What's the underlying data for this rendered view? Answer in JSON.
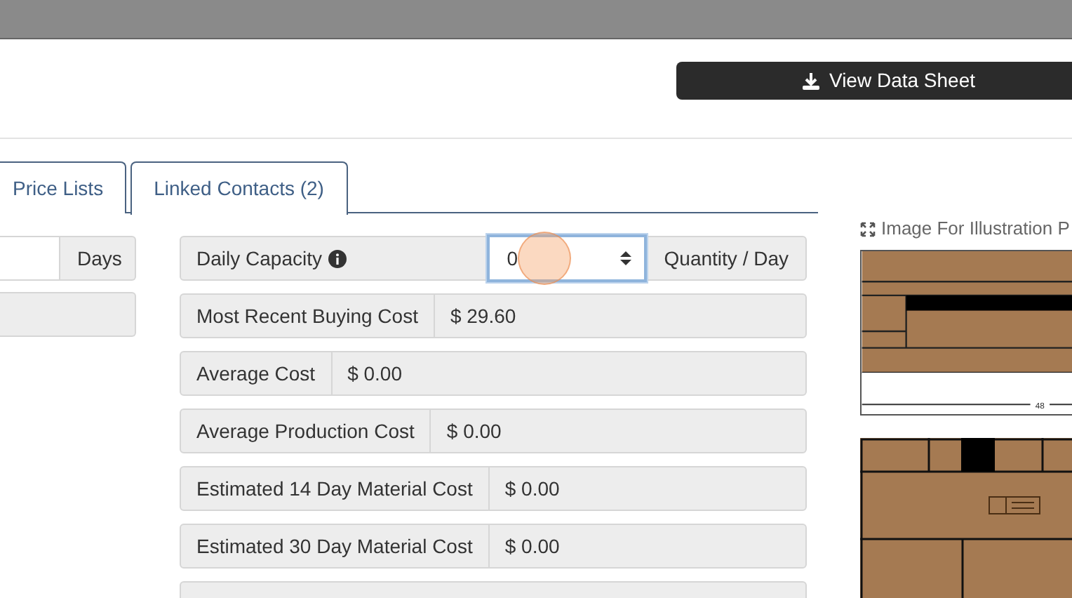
{
  "toolbar": {
    "download_button": "View Data Sheet"
  },
  "tabs": [
    {
      "label": "Price Lists",
      "selected": false
    },
    {
      "label": "Linked Contacts (2)",
      "selected": true
    }
  ],
  "left_fields": [
    {
      "kind": "addon",
      "addon": "Days"
    },
    {
      "kind": "blank"
    }
  ],
  "fields": [
    {
      "kind": "input",
      "label": "Daily Capacity",
      "info": true,
      "value": "0",
      "addon": "Quantity / Day",
      "focused": true
    },
    {
      "kind": "readout",
      "label": "Most Recent Buying Cost",
      "value": "$ 29.60"
    },
    {
      "kind": "readout",
      "label": "Average Cost",
      "value": "$ 0.00"
    },
    {
      "kind": "readout",
      "label": "Average Production Cost",
      "value": "$ 0.00"
    },
    {
      "kind": "readout",
      "label": "Estimated 14 Day Material Cost",
      "value": "$ 0.00"
    },
    {
      "kind": "readout",
      "label": "Estimated 30 Day Material Cost",
      "value": "$ 0.00"
    }
  ],
  "illustration": {
    "title": "Image For Illustration P",
    "dimension": "48"
  }
}
